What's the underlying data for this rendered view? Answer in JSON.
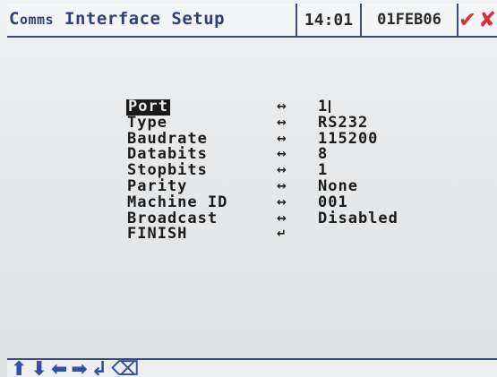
{
  "header": {
    "title_prefix": "C",
    "title_small": "omms",
    "title_rest": " Interface Setup",
    "time": "14:01",
    "date": "01FEB06",
    "confirm_icon": "check-icon",
    "cancel_icon": "cross-icon",
    "confirm_glyph": "✔",
    "cancel_glyph": "✘"
  },
  "menu": {
    "items": [
      {
        "label": "Port",
        "arrow": "↔",
        "value": "1",
        "selected": true
      },
      {
        "label": "Type",
        "arrow": "↔",
        "value": "RS232"
      },
      {
        "label": "Baudrate",
        "arrow": "↔",
        "value": "115200"
      },
      {
        "label": "Databits",
        "arrow": "↔",
        "value": "8"
      },
      {
        "label": "Stopbits",
        "arrow": "↔",
        "value": "1"
      },
      {
        "label": "Parity",
        "arrow": "↔",
        "value": "None"
      },
      {
        "label": "Machine ID",
        "arrow": "↔",
        "value": "001"
      },
      {
        "label": "Broadcast",
        "arrow": "↔",
        "value": "Disabled"
      },
      {
        "label": "FINISH",
        "arrow": "↵",
        "value": ""
      }
    ]
  },
  "footer": {
    "keys": [
      {
        "name": "up-arrow-icon",
        "glyph": "⬆"
      },
      {
        "name": "down-arrow-icon",
        "glyph": "⬇"
      },
      {
        "name": "left-arrow-icon",
        "glyph": "⬅"
      },
      {
        "name": "right-arrow-icon",
        "glyph": "➡"
      },
      {
        "name": "enter-icon",
        "glyph": "↲"
      },
      {
        "name": "backspace-icon",
        "glyph": "⌫"
      }
    ]
  },
  "colors": {
    "accent": "#2f3f7a",
    "confirm": "#d93038",
    "keys": "#2f4fa8"
  }
}
